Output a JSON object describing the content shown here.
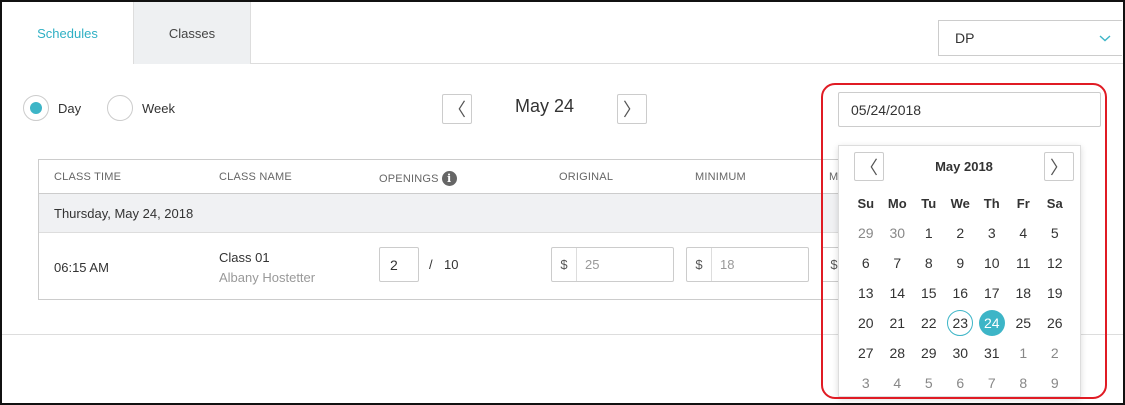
{
  "tabs": {
    "schedules": "Schedules",
    "classes": "Classes"
  },
  "location_select": {
    "value": "DP"
  },
  "view_mode": {
    "day": "Day",
    "week": "Week",
    "selected": "day"
  },
  "date_nav": {
    "title": "May 24",
    "prev": "〈",
    "next": "〉"
  },
  "table": {
    "headers": [
      "CLASS TIME",
      "CLASS NAME",
      "OPENINGS",
      "ORIGINAL",
      "MINIMUM",
      "M"
    ],
    "day_label": "Thursday, May 24, 2018",
    "row": {
      "time": "06:15 AM",
      "name": "Class 01",
      "instructor": "Albany Hostetter",
      "openings": "2",
      "separator": "/",
      "capacity": "10",
      "currency": "$",
      "original": "25",
      "minimum": "18"
    }
  },
  "date_input": {
    "value": "05/24/2018"
  },
  "calendar": {
    "title": "May 2018",
    "prev": "〈",
    "next": "〉",
    "weekdays": [
      "Su",
      "Mo",
      "Tu",
      "We",
      "Th",
      "Fr",
      "Sa"
    ],
    "days": [
      {
        "d": "29",
        "muted": true
      },
      {
        "d": "30",
        "muted": true
      },
      {
        "d": "1"
      },
      {
        "d": "2"
      },
      {
        "d": "3"
      },
      {
        "d": "4"
      },
      {
        "d": "5"
      },
      {
        "d": "6"
      },
      {
        "d": "7"
      },
      {
        "d": "8"
      },
      {
        "d": "9"
      },
      {
        "d": "10"
      },
      {
        "d": "11"
      },
      {
        "d": "12"
      },
      {
        "d": "13"
      },
      {
        "d": "14"
      },
      {
        "d": "15"
      },
      {
        "d": "16"
      },
      {
        "d": "17"
      },
      {
        "d": "18"
      },
      {
        "d": "19"
      },
      {
        "d": "20"
      },
      {
        "d": "21"
      },
      {
        "d": "22"
      },
      {
        "d": "23",
        "today": true
      },
      {
        "d": "24",
        "selected": true
      },
      {
        "d": "25"
      },
      {
        "d": "26"
      },
      {
        "d": "27"
      },
      {
        "d": "28"
      },
      {
        "d": "29"
      },
      {
        "d": "30"
      },
      {
        "d": "31"
      },
      {
        "d": "1",
        "muted": true
      },
      {
        "d": "2",
        "muted": true
      },
      {
        "d": "3",
        "muted": true
      },
      {
        "d": "4",
        "muted": true
      },
      {
        "d": "5",
        "muted": true
      },
      {
        "d": "6",
        "muted": true
      },
      {
        "d": "7",
        "muted": true
      },
      {
        "d": "8",
        "muted": true
      },
      {
        "d": "9",
        "muted": true
      }
    ]
  },
  "colors": {
    "accent": "#3db5c7",
    "tab_active": "#2fb0c4",
    "highlight": "#e01b24"
  }
}
